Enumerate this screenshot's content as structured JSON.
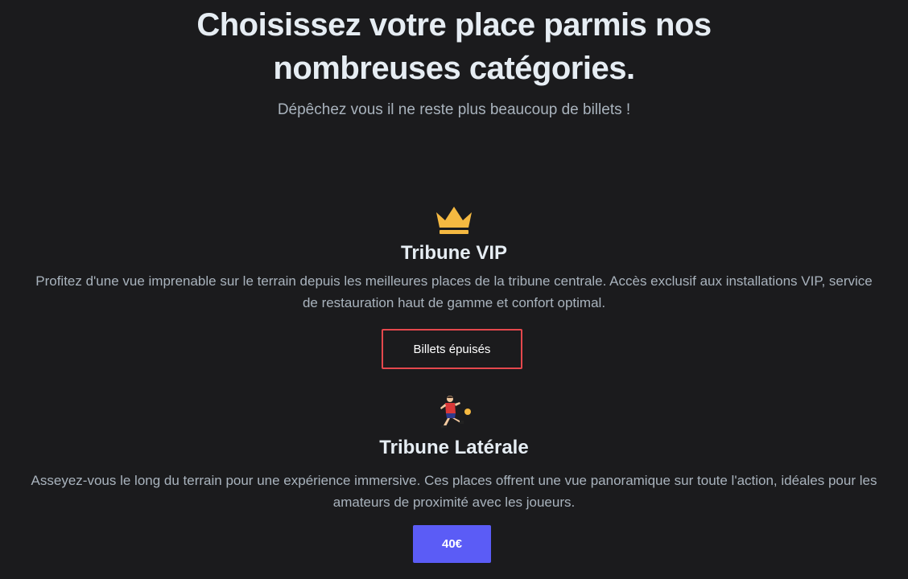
{
  "hero": {
    "title_line1": "Choisissez votre place parmis nos",
    "title_line2": "nombreuses catégories.",
    "subtitle": "Dépêchez vous il ne reste plus beaucoup de billets !"
  },
  "categories": [
    {
      "icon": "crown-icon",
      "title": "Tribune VIP",
      "description": "Profitez d'une vue imprenable sur le terrain depuis les meilleures places de la tribune centrale. Accès exclusif aux installations VIP, service de restauration haut de gamme et confort optimal.",
      "button_label": "Billets épuisés",
      "button_border_color": "#e5484d"
    },
    {
      "icon": "soccer-player-icon",
      "title": "Tribune Latérale",
      "description": "Asseyez-vous le long du terrain pour une expérience immersive. Ces places offrent une vue panoramique sur toute l'action, idéales pour les amateurs de proximité avec les joueurs.",
      "button_label": "40€",
      "button_color": "#5b5cf6"
    }
  ],
  "colors": {
    "background": "#1b1b1d",
    "heading": "#e6edf3",
    "muted_text": "#a9b3bd",
    "crown": "#f5b941"
  }
}
